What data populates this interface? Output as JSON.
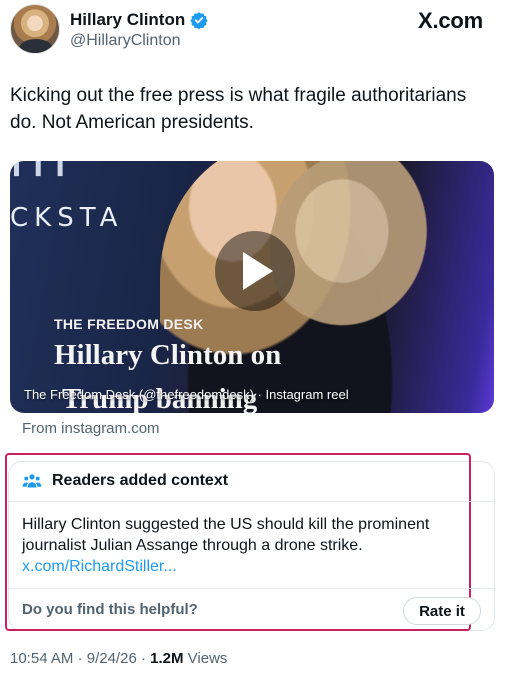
{
  "author": {
    "display_name": "Hillary Clinton",
    "handle": "@HillaryClinton",
    "verified_icon": "verified-badge-icon",
    "verified_color": "#1d9bf0"
  },
  "source_brand": "X.com",
  "tweet": {
    "text": "Kicking out the free press is what fragile authoritarians do. Not American presidents."
  },
  "media": {
    "overlay_text_1": "CKSTA",
    "overlay_desk": "THE FREEDOM DESK",
    "overlay_headline_1": "Hillary Clinton on",
    "overlay_headline_2": "Trump banning",
    "caption": "The Freedom Desk (@thefreedomdesk) · Instagram reel",
    "play_icon": "play-icon"
  },
  "from_source": "From instagram.com",
  "community_note": {
    "title": "Readers added context",
    "icon": "people-icon",
    "body": "Hillary Clinton suggested the US should kill the prominent journalist Julian Assange through a drone strike.",
    "link": "x.com/RichardStiller...",
    "helpful_question": "Do you find this helpful?",
    "rate_label": "Rate it",
    "highlight_color": "#c8205a"
  },
  "meta": {
    "time": "10:54 AM",
    "date": "9/24/26",
    "views_count": "1.2M",
    "views_label": "Views"
  }
}
